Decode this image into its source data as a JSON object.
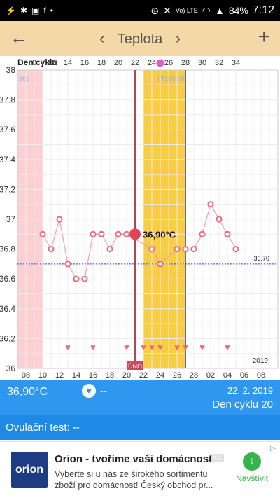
{
  "status_bar": {
    "left_icons": [
      "usb-icon",
      "settings-icon",
      "image-icon",
      "facebook-icon",
      "more-icon"
    ],
    "network": "Vo) LTE",
    "battery": "84%",
    "time": "7:12"
  },
  "header": {
    "title": "Teplota",
    "back_icon": "←",
    "prev_icon": "‹",
    "next_icon": "›",
    "add_icon": "+"
  },
  "chart_data": {
    "type": "line",
    "top_axis_label": "Den cyklu",
    "cycle_ticks": [
      "0",
      "12",
      "14",
      "16",
      "18",
      "20",
      "22",
      "24",
      "26",
      "28",
      "30",
      "32",
      "34"
    ],
    "date_ticks": [
      "08",
      "10",
      "12",
      "14",
      "16",
      "18",
      "20",
      "22",
      "24",
      "26",
      "28",
      "02",
      "04",
      "06",
      "08"
    ],
    "ylim": [
      36,
      38
    ],
    "y_ticks": [
      "38",
      "37.8",
      "37.6",
      "37.4",
      "37.2",
      "37",
      "36.8",
      "36.6",
      "36.4",
      "36.2",
      "36"
    ],
    "date_range": [
      8,
      39
    ],
    "menses_label": "ses",
    "menses_range": [
      8,
      11
    ],
    "fertile_label": "Plodnost",
    "fertile_range": [
      23,
      28
    ],
    "coverline": 36.7,
    "coverline_label": "36,70",
    "selected": {
      "x": 22,
      "y": 36.9,
      "label": "36,90°C",
      "badge": "ÚNO"
    },
    "marker_line_x": 28,
    "year_label": "2019",
    "series": [
      {
        "points": [
          [
            11,
            36.9
          ],
          [
            12,
            36.8
          ],
          [
            13,
            37.0
          ],
          [
            14,
            36.7
          ],
          [
            15,
            36.6
          ],
          [
            16,
            36.6
          ],
          [
            17,
            36.9
          ],
          [
            18,
            36.9
          ],
          [
            19,
            36.8
          ],
          [
            20,
            36.9
          ],
          [
            21,
            36.9
          ],
          [
            24,
            36.8
          ],
          [
            25,
            36.7
          ],
          [
            27,
            36.8
          ],
          [
            28,
            36.8
          ],
          [
            29,
            36.8
          ],
          [
            30,
            36.9
          ],
          [
            31,
            37.1
          ],
          [
            32,
            37.0
          ],
          [
            33,
            36.9
          ],
          [
            34,
            36.8
          ]
        ]
      }
    ],
    "hearts_x": [
      14,
      17,
      21,
      23,
      24,
      25,
      27,
      28,
      30,
      33
    ]
  },
  "info": {
    "temperature": "36,90°C",
    "heart_icon": "♥",
    "heart_value": "--",
    "date": "22. 2. 2019",
    "cycle_day": "Den cyklu 20"
  },
  "ovulation": {
    "label": "Ovulační test: --"
  },
  "ad": {
    "logo_text": "orion",
    "title": "Orion - tvoříme vaši domácnost",
    "badge": "AD",
    "text": "Vyberte si u nás ze širokého sortimentu zboží pro domácnost! Český obchod pr...",
    "button": "Navštívit",
    "button_icon": "↓"
  }
}
